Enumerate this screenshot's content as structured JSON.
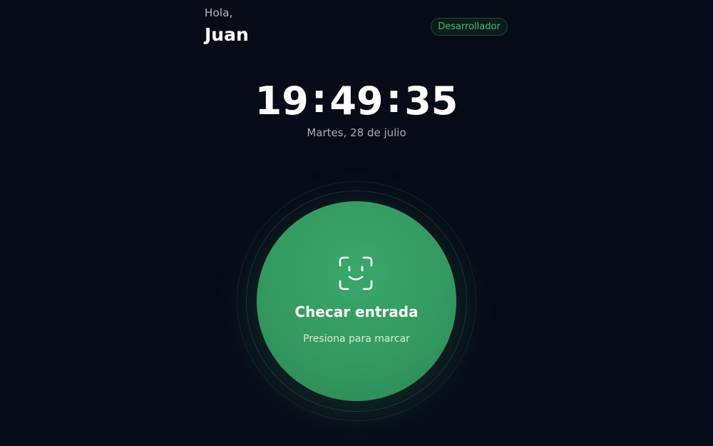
{
  "header": {
    "greeting": "Hola,",
    "username": "Juan",
    "role_badge": "Desarrollador"
  },
  "clock": {
    "hours": "19",
    "minutes": "49",
    "seconds": "35",
    "separator": ":",
    "date": "Martes, 28 de julio"
  },
  "checkin": {
    "icon": "face-id-icon",
    "label": "Checar entrada",
    "sublabel": "Presiona para marcar"
  },
  "colors": {
    "background": "#070b18",
    "accent": "#3fbd77",
    "button": "#33985f"
  }
}
